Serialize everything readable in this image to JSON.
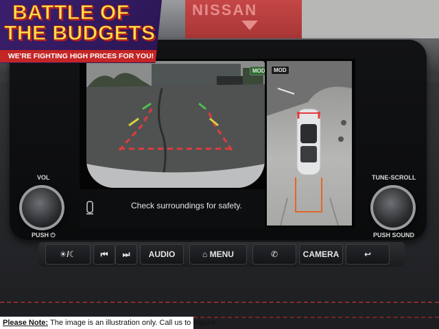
{
  "banner": {
    "line1": "BATTLE OF",
    "line2": "THE BUDGETS",
    "subline": "WE'RE FIGHTING HIGH PRICES FOR YOU!"
  },
  "dealer_sign": "NISSAN",
  "screen": {
    "camera_mode_badge": "MOD",
    "birdseye_mode_badge": "MOD",
    "message": "Check surroundings for safety."
  },
  "knobs": {
    "left_label_top": "VOL",
    "left_label_bottom": "PUSH ⏻",
    "right_label_top": "TUNE-SCROLL",
    "right_label_bottom": "PUSH SOUND"
  },
  "buttons": {
    "day_night": "☀/☾",
    "prev": "⏮",
    "next": "⏭",
    "audio": "AUDIO",
    "menu": "⌂ MENU",
    "phone": "✆",
    "camera": "CAMERA",
    "back": "↩"
  },
  "disclaimer": {
    "prefix": "Please Note:",
    "text": "The image is an illustration only. Call us to inquire."
  },
  "colors": {
    "guide_red": "#e23b3b",
    "guide_yellow": "#d8d23a",
    "guide_green": "#4fbf4f",
    "guide_orange": "#e2662a",
    "banner_yellow": "#ffe14a",
    "banner_red": "#c42525",
    "banner_purple": "#3b1f6e"
  }
}
